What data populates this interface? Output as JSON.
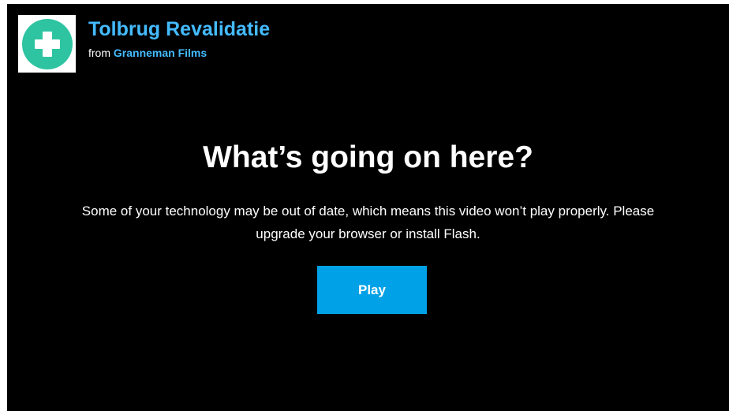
{
  "header": {
    "title": "Tolbrug Revalidatie",
    "byline_prefix": "from",
    "owner": "Granneman Films",
    "portrait_icon": "plus-circle-icon",
    "portrait_color": "#2ec4a1"
  },
  "message": {
    "heading": "What’s going on here?",
    "explanation": "Some of your technology may be out of date, which means this video won’t play properly. Please upgrade your browser or install Flash."
  },
  "actions": {
    "play_label": "Play"
  },
  "colors": {
    "background": "#000000",
    "accent_link": "#44bbff",
    "button": "#00a1e6",
    "text": "#ffffff"
  }
}
